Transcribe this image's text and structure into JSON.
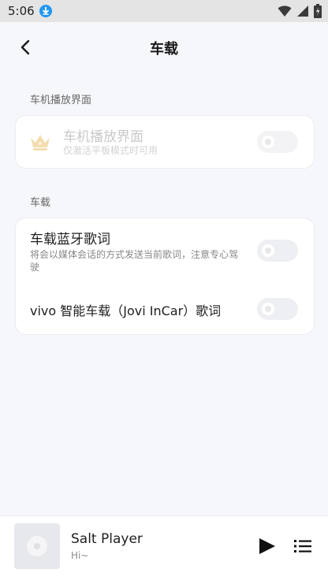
{
  "statusbar": {
    "time": "5:06"
  },
  "header": {
    "title": "车载"
  },
  "sections": [
    {
      "label": "车机播放界面"
    },
    {
      "label": "车载"
    }
  ],
  "car_ui_card": {
    "title": "车机播放界面",
    "subtitle": "仅激活平板模式时可用",
    "enabled": false,
    "toggle_on": false
  },
  "car_card": {
    "items": [
      {
        "title": "车载蓝牙歌词",
        "subtitle": "将会以媒体会话的方式发送当前歌词，注意专心驾驶",
        "toggle_on": false
      },
      {
        "title": "vivo 智能车载（Jovi InCar）歌词",
        "toggle_on": false
      }
    ]
  },
  "player": {
    "title": "Salt Player",
    "subtitle": "Hi~"
  },
  "colors": {
    "background": "#f6f7fa",
    "card": "#ffffff",
    "statusbar": "#e4e4e4",
    "accent": "#2196f3"
  }
}
